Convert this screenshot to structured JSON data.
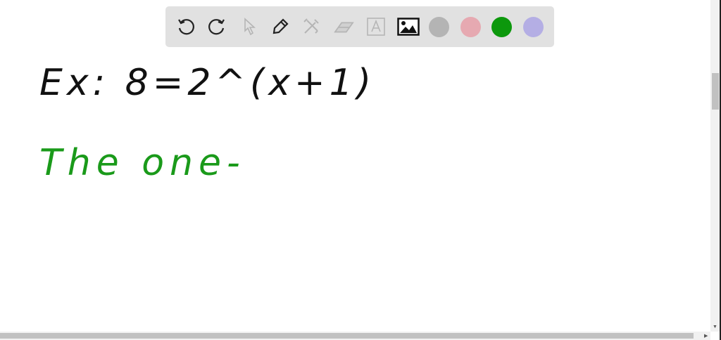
{
  "toolbar": {
    "tools": [
      {
        "name": "undo",
        "icon": "undo-icon"
      },
      {
        "name": "redo",
        "icon": "redo-icon"
      },
      {
        "name": "select",
        "icon": "cursor-icon"
      },
      {
        "name": "pen",
        "icon": "pen-icon"
      },
      {
        "name": "tools",
        "icon": "tools-icon"
      },
      {
        "name": "eraser",
        "icon": "eraser-icon"
      },
      {
        "name": "text",
        "icon": "text-box-icon"
      },
      {
        "name": "image",
        "icon": "image-icon"
      }
    ],
    "colors": [
      "#b4b4b4",
      "#e6a9b1",
      "#0c980c",
      "#b4aee4"
    ]
  },
  "ink": {
    "line1": "Ex: 8=2^(x+1)",
    "line1_color": "#111111",
    "line2": "The one-",
    "line2_color": "#1a9a1a"
  }
}
